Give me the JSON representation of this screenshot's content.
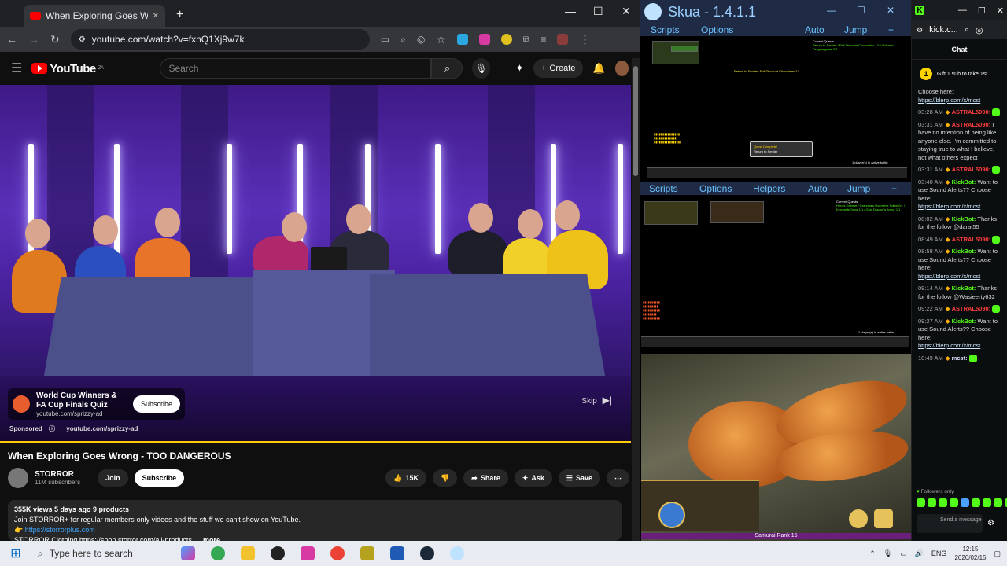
{
  "chrome": {
    "tab_title": "When Exploring Goes Wrong",
    "url": "youtube.com/watch?v=fxnQ1Xj9w7k",
    "new_tab": "+",
    "minimize": "—",
    "maximize": "☐",
    "close": "✕"
  },
  "youtube": {
    "logo_text": "YouTube",
    "region": "ZA",
    "search_placeholder": "Search",
    "create_label": "Create",
    "ad": {
      "title": "World Cup Winners & FA Cup Finals Quiz",
      "url": "youtube.com/sprizzy-ad",
      "subscribe": "Subscribe",
      "skip": "Skip",
      "sponsored": "Sponsored",
      "sponsored_url": "youtube.com/sprizzy-ad",
      "progress": 1.0
    },
    "video_title": "When Exploring Goes Wrong - TOO DANGEROUS",
    "channel": {
      "name": "STORROR",
      "subs": "11M subscribers",
      "join": "Join",
      "subscribe": "Subscribe"
    },
    "actions": {
      "likes": "15K",
      "share": "Share",
      "ask": "Ask",
      "save": "Save"
    },
    "description": {
      "meta": "355K views  5 days ago  9 products",
      "line1": "Join STORROR+ for regular members-only videos and the stuff we can't show on YouTube.",
      "link1": "https://storrorplus.com",
      "line3": "STORROR Clothing https://shop.storror.com/all-products",
      "more": "...more"
    }
  },
  "skua": {
    "title": "Skua - 1.4.1.1",
    "menu_top": {
      "scripts": "Scripts",
      "options": "Options",
      "auto": "Auto",
      "jump": "Jump",
      "plus": "+"
    },
    "menu_mid": {
      "scripts": "Scripts",
      "options": "Options",
      "helpers": "Helpers",
      "auto": "Auto",
      "jump": "Jump",
      "plus": "+"
    },
    "pane1": {
      "quest_title": "Current Quests",
      "quest_lines": "Return to Sender / Ebil Discount Chocolates 1/1 / Volcanic Dragonsgems 0/1",
      "banner": "Return to Sender: Ebil Discount Chocolates 1/1",
      "quest_complete": "Quest Complete!",
      "quest_complete_sub": "Return to Sender",
      "player_notice": "1 player(s) in active battle"
    },
    "pane2": {
      "quest_title": "Current Quests",
      "quest_lines": "Hero's Cabinet / Grandpa's Overdrive Token 0/1 / Kerchiefs Tome 1/1 / Gold Dragon's Armor 1/1",
      "player_notice": "1 player(s) in active battle"
    },
    "rank_text": "Samurai Rank 15"
  },
  "kick": {
    "url": "kick.c...",
    "chat_label": "Chat",
    "gift_text": "Gift 1 sub to take 1st",
    "messages": [
      {
        "time": "",
        "user": "",
        "text": "Choose here:",
        "link": "https://blerp.com/x/mcst"
      },
      {
        "time": "03:28 AM",
        "user": "ASTRAL5090:",
        "text": "",
        "link": ""
      },
      {
        "time": "03:31 AM",
        "user": "ASTRAL5090:",
        "text": "I have no intention of being like anyone else. I'm committed to staying true to what I believe, not what others expect",
        "link": ""
      },
      {
        "time": "03:31 AM",
        "user": "ASTRAL5090:",
        "text": "",
        "link": ""
      },
      {
        "time": "03:40 AM",
        "user": "KickBot:",
        "text": "Want to use Sound Alerts?? Choose here:",
        "link": "https://blerp.com/x/mcst"
      },
      {
        "time": "08:02 AM",
        "user": "KickBot:",
        "text": "Thanks for the follow @darat55",
        "link": ""
      },
      {
        "time": "08:49 AM",
        "user": "ASTRAL5090:",
        "text": "",
        "link": ""
      },
      {
        "time": "08:58 AM",
        "user": "KickBot:",
        "text": "Want to use Sound Alerts?? Choose here:",
        "link": "https://blerp.com/x/mcst"
      },
      {
        "time": "09:14 AM",
        "user": "KickBot:",
        "text": "Thanks for the follow @Wasieerty632",
        "link": ""
      },
      {
        "time": "09:22 AM",
        "user": "ASTRAL5090:",
        "text": "",
        "link": ""
      },
      {
        "time": "09:27 AM",
        "user": "KickBot:",
        "text": "Want to use Sound Alerts?? Choose here:",
        "link": "https://blerp.com/x/mcst"
      },
      {
        "time": "10:49 AM",
        "user": "mcst:",
        "text": "",
        "link": ""
      }
    ],
    "followers_only": "Followers only",
    "send_placeholder": "Send a message"
  },
  "taskbar": {
    "search_placeholder": "Type here to search",
    "lang": "ENG",
    "time": "12:15",
    "date": "2026/02/15"
  },
  "colors": {
    "youtube_red": "#ff0000",
    "kick_green": "#53fc18",
    "skua_blue": "#6cc3ff",
    "ad_progress": "#ffcc00"
  }
}
